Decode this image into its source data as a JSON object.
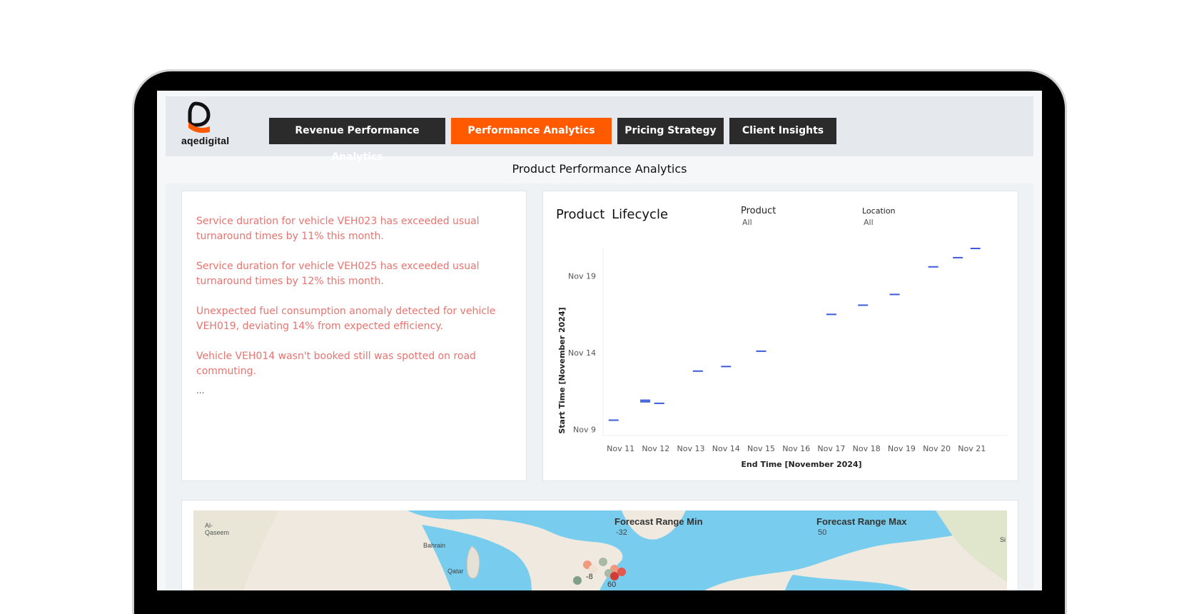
{
  "brand": {
    "name": "aqedigital",
    "accent": "#ff5a00",
    "dark": "#2b2b2b"
  },
  "nav": {
    "tabs": [
      {
        "label": "Revenue Performance Analytics",
        "active": false
      },
      {
        "label": "Performance Analytics",
        "active": true
      },
      {
        "label": "Pricing Strategy",
        "active": false
      },
      {
        "label": "Client Insights",
        "active": false
      }
    ]
  },
  "page": {
    "title": "Product Performance Analytics"
  },
  "alerts": {
    "items": [
      "Service duration for vehicle VEH023 has exceeded usual turnaround times by 11% this month.",
      "Service duration for vehicle VEH025 has exceeded usual turnaround times by 12% this month.",
      "Unexpected fuel consumption anomaly detected for vehicle VEH019, deviating 14% from expected efficiency.",
      "Vehicle VEH014 wasn't booked still was spotted on road commuting."
    ],
    "more": "..."
  },
  "lifecycle": {
    "title": "Product  Lifecycle",
    "filters": {
      "product": {
        "label": "Product",
        "value": "All"
      },
      "location": {
        "label": "Location",
        "value": "All"
      }
    }
  },
  "chart_data": {
    "type": "scatter",
    "mark": "dash",
    "xlabel": "End Time [November 2024]",
    "ylabel": "Start Time [November 2024]",
    "x_ticks": [
      11,
      12,
      13,
      14,
      15,
      16,
      17,
      18,
      19,
      20,
      21
    ],
    "x_tick_labels": [
      "Nov 11",
      "Nov 12",
      "Nov 13",
      "Nov 14",
      "Nov 15",
      "Nov 16",
      "Nov 17",
      "Nov 18",
      "Nov 19",
      "Nov 20",
      "Nov 21"
    ],
    "y_ticks": [
      9,
      14,
      19
    ],
    "y_tick_labels": [
      "Nov 9",
      "Nov 14",
      "Nov 19"
    ],
    "xlim": [
      10.5,
      22
    ],
    "ylim": [
      8.6,
      20.8
    ],
    "color": "#3b5bdb",
    "points": [
      {
        "x": 10.8,
        "y": 9.6
      },
      {
        "x": 11.7,
        "y": 10.8
      },
      {
        "x": 11.7,
        "y": 10.9
      },
      {
        "x": 12.1,
        "y": 10.7
      },
      {
        "x": 13.2,
        "y": 12.8
      },
      {
        "x": 14.0,
        "y": 13.1
      },
      {
        "x": 15.0,
        "y": 14.1
      },
      {
        "x": 17.0,
        "y": 16.5
      },
      {
        "x": 17.9,
        "y": 17.1
      },
      {
        "x": 18.8,
        "y": 17.8
      },
      {
        "x": 19.9,
        "y": 19.6
      },
      {
        "x": 20.6,
        "y": 20.2
      },
      {
        "x": 21.1,
        "y": 20.8
      }
    ]
  },
  "map": {
    "land_color": "#efe9df",
    "water_color": "#78cdee",
    "places": [
      "Al-Qaseem",
      "Bahrain",
      "Qatar",
      "Si"
    ],
    "forecast_min": {
      "label": "Forecast Range Min",
      "value": "-32"
    },
    "forecast_max": {
      "label": "Forecast Range Max",
      "value": "50"
    },
    "marker_labels": [
      "-8",
      "60"
    ]
  }
}
